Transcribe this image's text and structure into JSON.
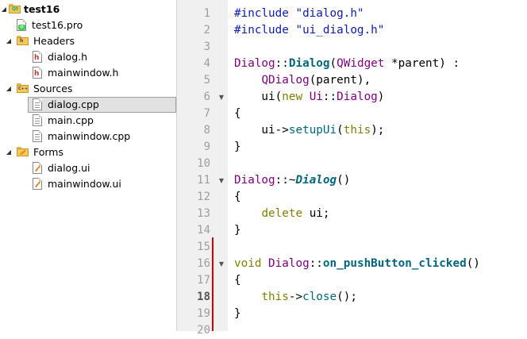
{
  "project_tree": {
    "nodes": [
      {
        "label": "test16",
        "kind": "project",
        "expanded": true,
        "bold": true
      },
      {
        "label": "test16.pro",
        "kind": "pro-file"
      },
      {
        "label": "Headers",
        "kind": "folder",
        "expanded": true,
        "badge": "h"
      },
      {
        "label": "dialog.h",
        "kind": "header-file"
      },
      {
        "label": "mainwindow.h",
        "kind": "header-file"
      },
      {
        "label": "Sources",
        "kind": "folder",
        "expanded": true,
        "badge": "C++"
      },
      {
        "label": "dialog.cpp",
        "kind": "source-file",
        "selected": true
      },
      {
        "label": "main.cpp",
        "kind": "source-file"
      },
      {
        "label": "mainwindow.cpp",
        "kind": "source-file"
      },
      {
        "label": "Forms",
        "kind": "folder",
        "expanded": true,
        "badge": ""
      },
      {
        "label": "dialog.ui",
        "kind": "form-file"
      },
      {
        "label": "mainwindow.ui",
        "kind": "form-file"
      }
    ]
  },
  "editor": {
    "current_line": "18",
    "line_numbers": [
      "1",
      "2",
      "3",
      "4",
      "5",
      "6",
      "7",
      "8",
      "9",
      "10",
      "11",
      "12",
      "13",
      "14",
      "15",
      "16",
      "17",
      "18",
      "19",
      "20"
    ],
    "code": [
      [
        {
          "t": "#include ",
          "c": "pp"
        },
        {
          "t": "\"dialog.h\"",
          "c": "str"
        }
      ],
      [
        {
          "t": "#include ",
          "c": "pp"
        },
        {
          "t": "\"ui_dialog.h\"",
          "c": "str"
        }
      ],
      [],
      [
        {
          "t": "Dialog",
          "c": "cls"
        },
        {
          "t": "::",
          "c": "op"
        },
        {
          "t": "Dialog",
          "c": "fnb"
        },
        {
          "t": "(",
          "c": "op"
        },
        {
          "t": "QWidget",
          "c": "cls"
        },
        {
          "t": " *parent) :",
          "c": "op"
        }
      ],
      [
        {
          "t": "    ",
          "c": "op"
        },
        {
          "t": "QDialog",
          "c": "cls"
        },
        {
          "t": "(parent),",
          "c": "op"
        }
      ],
      [
        {
          "t": "    ui(",
          "c": "op"
        },
        {
          "t": "new",
          "c": "kw"
        },
        {
          "t": " ",
          "c": "op"
        },
        {
          "t": "Ui",
          "c": "cls"
        },
        {
          "t": "::",
          "c": "op"
        },
        {
          "t": "Dialog",
          "c": "cls"
        },
        {
          "t": ")",
          "c": "op"
        }
      ],
      [
        {
          "t": "{",
          "c": "op"
        }
      ],
      [
        {
          "t": "    ui->",
          "c": "op"
        },
        {
          "t": "setupUi",
          "c": "fn"
        },
        {
          "t": "(",
          "c": "op"
        },
        {
          "t": "this",
          "c": "kw"
        },
        {
          "t": ");",
          "c": "op"
        }
      ],
      [
        {
          "t": "}",
          "c": "op"
        }
      ],
      [],
      [
        {
          "t": "Dialog",
          "c": "cls"
        },
        {
          "t": "::~",
          "c": "op"
        },
        {
          "t": "Dialog",
          "c": "fni"
        },
        {
          "t": "()",
          "c": "op"
        }
      ],
      [
        {
          "t": "{",
          "c": "op"
        }
      ],
      [
        {
          "t": "    ",
          "c": "op"
        },
        {
          "t": "delete",
          "c": "kw"
        },
        {
          "t": " ui;",
          "c": "op"
        }
      ],
      [
        {
          "t": "}",
          "c": "op"
        }
      ],
      [],
      [
        {
          "t": "void",
          "c": "kw"
        },
        {
          "t": " ",
          "c": "op"
        },
        {
          "t": "Dialog",
          "c": "cls"
        },
        {
          "t": "::",
          "c": "op"
        },
        {
          "t": "on_pushButton_clicked",
          "c": "fnb"
        },
        {
          "t": "()",
          "c": "op"
        }
      ],
      [
        {
          "t": "{",
          "c": "op"
        }
      ],
      [
        {
          "t": "    ",
          "c": "op"
        },
        {
          "t": "this",
          "c": "kw"
        },
        {
          "t": "->",
          "c": "op"
        },
        {
          "t": "close",
          "c": "fn"
        },
        {
          "t": "();",
          "c": "op"
        }
      ],
      [
        {
          "t": "}",
          "c": "op"
        }
      ],
      []
    ],
    "fold_markers_at_lines": [
      "6",
      "11",
      "16"
    ]
  },
  "colors": {
    "gutter_bg": "#f0f0f0",
    "change_marker": "#d50000",
    "selection_bg": "#e1e1e1"
  }
}
